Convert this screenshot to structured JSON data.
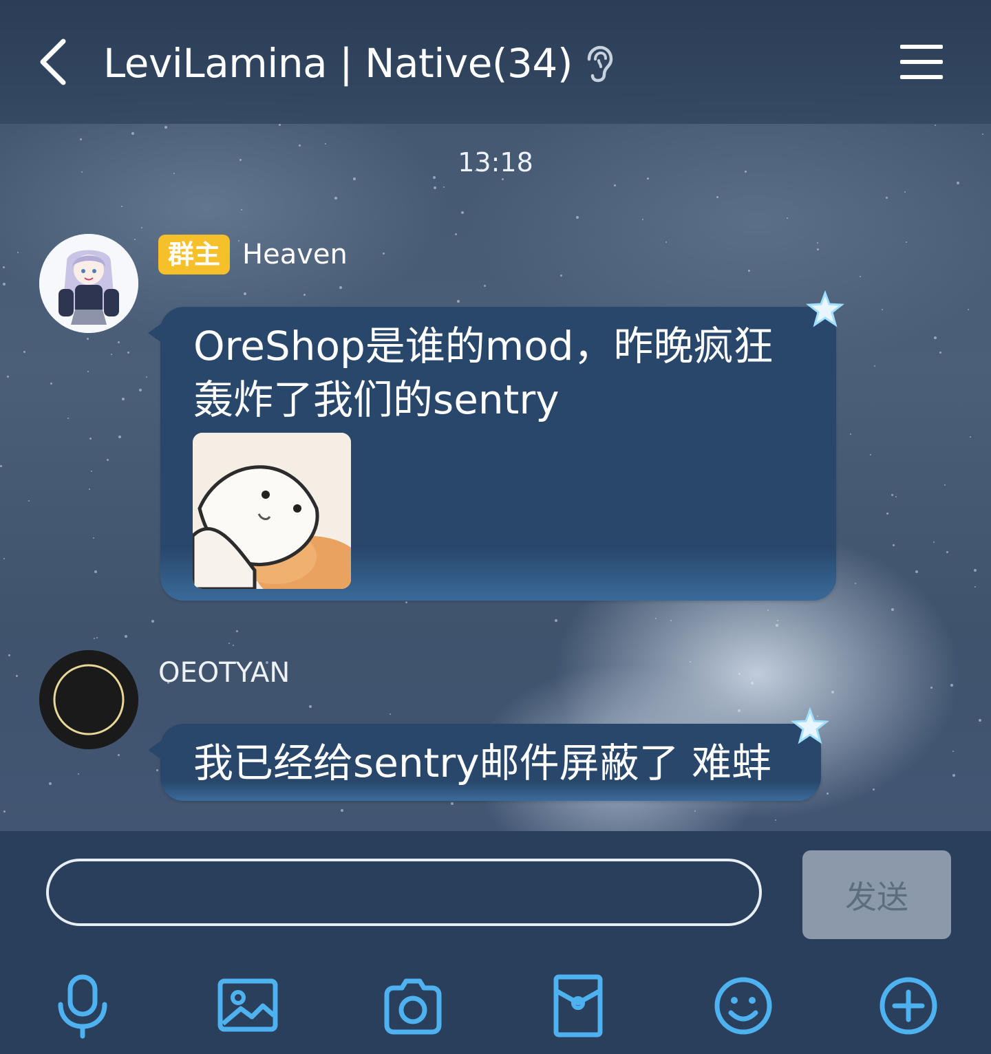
{
  "header": {
    "title": "LeviLamina | Native(34)",
    "back_icon": "chevron-left-icon",
    "listen_icon": "ear-icon",
    "menu_icon": "hamburger-menu-icon"
  },
  "chat": {
    "timestamp": "13:18",
    "messages": [
      {
        "sender": "Heaven",
        "badge": "群主",
        "text": "OreShop是谁的mod，昨晚疯狂轰炸了我们的sentry",
        "has_sticker": true
      },
      {
        "sender": "OEOTYAN",
        "text": "我已经给sentry邮件屏蔽了 难蚌"
      }
    ]
  },
  "composer": {
    "input_value": "",
    "send_label": "发送"
  },
  "toolbar": {
    "icons": [
      "microphone-icon",
      "image-icon",
      "camera-icon",
      "red-packet-icon",
      "emoji-icon",
      "plus-icon"
    ]
  },
  "colors": {
    "accent": "#4fb2f0",
    "badge": "#f6c02a",
    "bubble": "#28476b",
    "header": "#2a3c56",
    "send_disabled": "#8b99aa"
  }
}
